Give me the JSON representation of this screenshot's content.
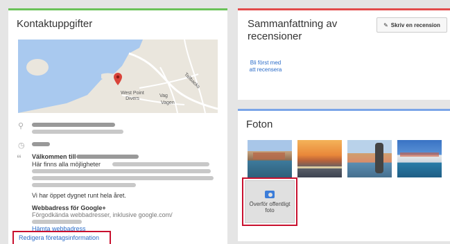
{
  "contact": {
    "title": "Kontaktuppgifter",
    "map": {
      "place_label": "West Point Divers",
      "street_labels": [
        "Vag",
        "Vagen",
        "Tallbacks"
      ]
    },
    "welcome_heading": "Välkommen till",
    "welcome_text": "Här finns alla möjligheter",
    "open_hours": "Vi har öppet dygnet runt hela året.",
    "web_heading": "Webbadress för Google+",
    "web_desc": "Förgodkända webbadresser, inklusive google.com/",
    "fetch_link": "Hämta webbadress",
    "edit_link": "Redigera företagsinformation"
  },
  "reviews": {
    "title": "Sammanfattning av recensioner",
    "write_button": "Skriv en recension",
    "first_link": "Bli först med att recensera"
  },
  "photos": {
    "title": "Foton",
    "upload_label": "Överför offentligt foto"
  },
  "colors": {
    "contact_accent": "#6ac259",
    "reviews_accent": "#e24c4c",
    "photos_accent": "#7aa5e8",
    "highlight": "#c8102e",
    "link": "#2a6bc8"
  },
  "icons": [
    "location-pin-icon",
    "clock-icon",
    "quote-icon",
    "pencil-icon",
    "camera-icon",
    "map-marker-icon"
  ]
}
